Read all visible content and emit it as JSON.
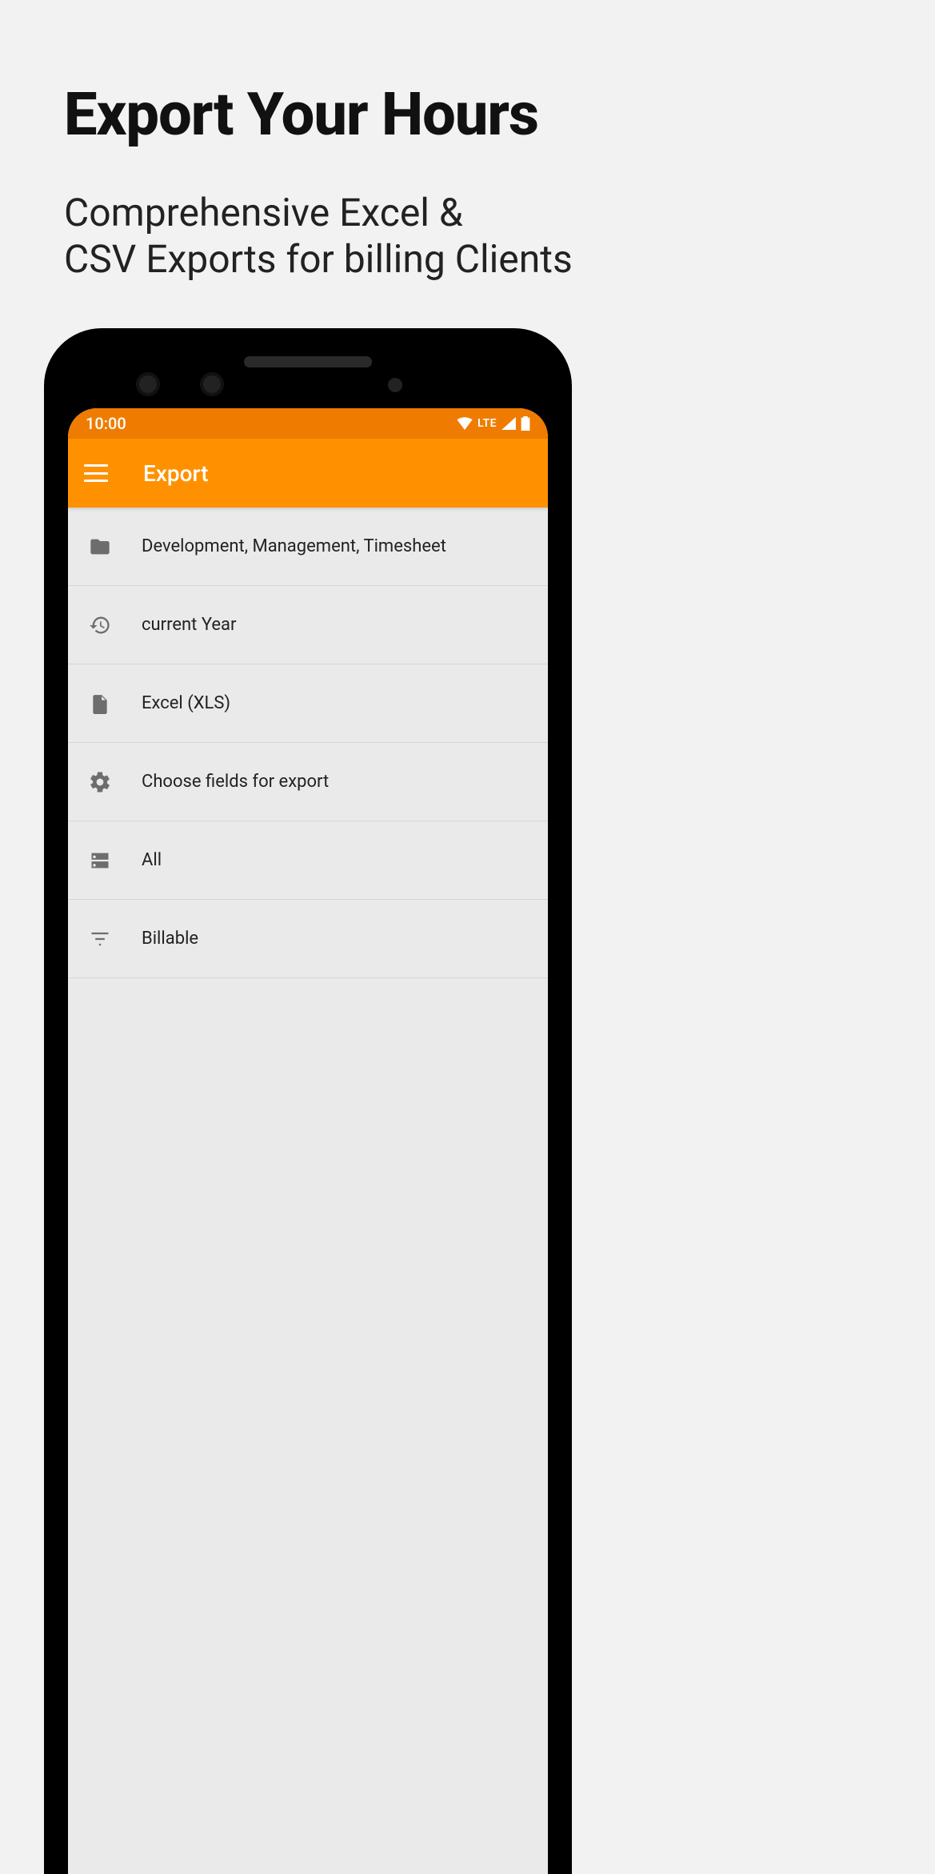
{
  "marketing": {
    "title": "Export Your Hours",
    "subtitle_line1": "Comprehensive Excel &",
    "subtitle_line2": "CSV Exports for billing Clients"
  },
  "status": {
    "time": "10:00",
    "network": "LTE"
  },
  "appbar": {
    "title": "Export"
  },
  "options": [
    {
      "key": "projects",
      "label": "Development, Management, Timesheet"
    },
    {
      "key": "range",
      "label": "current Year"
    },
    {
      "key": "format",
      "label": "Excel (XLS)"
    },
    {
      "key": "fields",
      "label": "Choose fields for export"
    },
    {
      "key": "grouping",
      "label": "All"
    },
    {
      "key": "filter",
      "label": "Billable"
    }
  ]
}
